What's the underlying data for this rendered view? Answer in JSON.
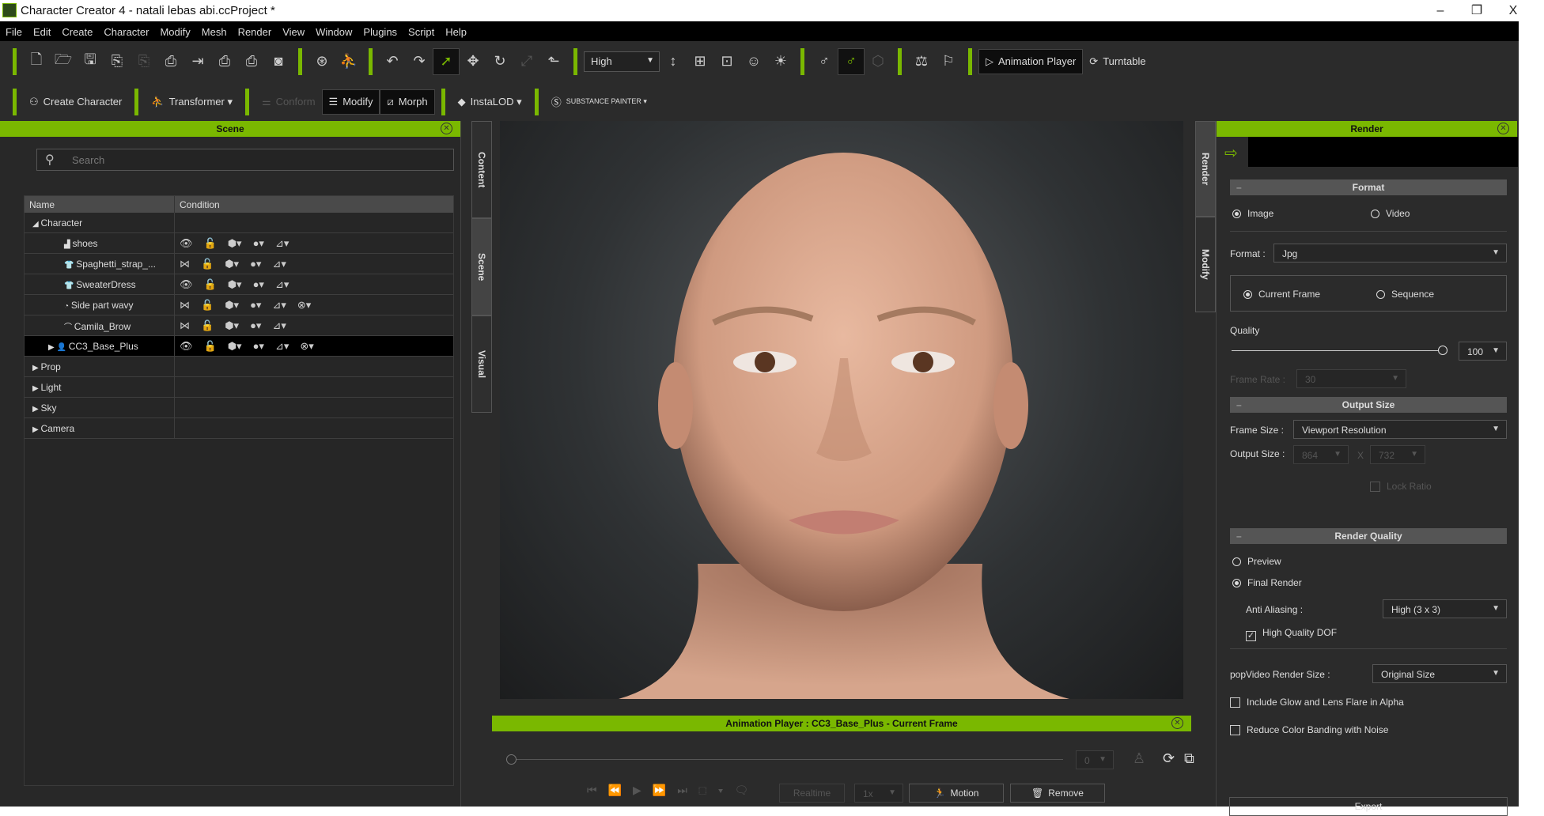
{
  "window": {
    "title": "Character Creator 4 - natali lebas abi.ccProject *",
    "minimize": "–",
    "restore": "❐",
    "close": "X"
  },
  "menu": [
    "File",
    "Edit",
    "Create",
    "Character",
    "Modify",
    "Mesh",
    "Render",
    "View",
    "Window",
    "Plugins",
    "Script",
    "Help"
  ],
  "toolbar1": [
    {
      "t": "sep"
    },
    {
      "t": "ic",
      "icon": "new-file-icon",
      "g": "🗋"
    },
    {
      "t": "ic",
      "icon": "open-folder-icon",
      "g": "🗁"
    },
    {
      "t": "ic",
      "icon": "save-icon",
      "g": "🖫"
    },
    {
      "t": "ic",
      "icon": "import-character-icon",
      "g": "⎘"
    },
    {
      "t": "ic",
      "icon": "import-ic-icon",
      "g": "⎘",
      "dim": true
    },
    {
      "t": "ic",
      "icon": "export-usd-icon",
      "g": "⎙"
    },
    {
      "t": "ic",
      "icon": "export-icon",
      "g": "⇥"
    },
    {
      "t": "ic",
      "icon": "export-obj-icon",
      "g": "⎙"
    },
    {
      "t": "ic",
      "icon": "export-fbx-icon",
      "g": "⎙"
    },
    {
      "t": "ic",
      "icon": "render-target-icon",
      "g": "◙"
    },
    {
      "t": "sep"
    },
    {
      "t": "ic",
      "icon": "headshot-icon",
      "g": "⊛"
    },
    {
      "t": "ic",
      "icon": "pose-icon",
      "g": "⛹"
    },
    {
      "t": "sep"
    },
    {
      "t": "ic",
      "icon": "undo-icon",
      "g": "↶"
    },
    {
      "t": "ic",
      "icon": "redo-icon",
      "g": "↷"
    },
    {
      "t": "ic",
      "icon": "select-arrow-icon",
      "g": "➚",
      "on": true
    },
    {
      "t": "ic",
      "icon": "move-icon",
      "g": "✥"
    },
    {
      "t": "ic",
      "icon": "rotate-icon",
      "g": "↻"
    },
    {
      "t": "ic",
      "icon": "scale-icon",
      "g": "⤢",
      "dim": true
    },
    {
      "t": "ic",
      "icon": "align-icon",
      "g": "⬑"
    },
    {
      "t": "sep"
    },
    {
      "t": "sel",
      "label": "High"
    },
    {
      "t": "ic",
      "icon": "fit-height-icon",
      "g": "↕"
    },
    {
      "t": "ic",
      "icon": "fit-view-icon",
      "g": "⊞"
    },
    {
      "t": "ic",
      "icon": "camera-view-icon",
      "g": "⊡"
    },
    {
      "t": "ic",
      "icon": "face-icon",
      "g": "☺"
    },
    {
      "t": "ic",
      "icon": "light-icon",
      "g": "☀"
    },
    {
      "t": "sep"
    },
    {
      "t": "ic",
      "icon": "bone-icon",
      "g": "♂"
    },
    {
      "t": "ic",
      "icon": "bone-active-icon",
      "g": "♂",
      "on": true
    },
    {
      "t": "ic",
      "icon": "cubes-icon",
      "g": "⬡",
      "dim": true
    },
    {
      "t": "sep"
    },
    {
      "t": "ic",
      "icon": "balance-icon",
      "g": "⚖"
    },
    {
      "t": "ic",
      "icon": "flag-icon",
      "g": "⚐"
    },
    {
      "t": "sep"
    },
    {
      "t": "btn",
      "icon": "play-circle-icon",
      "g": "▷",
      "label": "Animation Player",
      "dark": true
    },
    {
      "t": "btn",
      "icon": "turntable-icon",
      "g": "⟳",
      "label": "Turntable"
    }
  ],
  "toolbar2": [
    {
      "t": "sep"
    },
    {
      "t": "btn",
      "icon": "create-character-icon",
      "g": "⚇",
      "label": "Create Character"
    },
    {
      "t": "sep"
    },
    {
      "t": "btn",
      "icon": "transformer-icon",
      "g": "⛹",
      "label": "Transformer ▾"
    },
    {
      "t": "sep"
    },
    {
      "t": "btn",
      "icon": "conform-icon",
      "g": "⚌",
      "label": "Conform",
      "dim": true
    },
    {
      "t": "btn",
      "icon": "sliders-icon",
      "g": "☰",
      "label": "Modify",
      "dark": true
    },
    {
      "t": "btn",
      "icon": "morph-icon",
      "g": "⧄",
      "label": "Morph",
      "dark": true
    },
    {
      "t": "sep"
    },
    {
      "t": "btn",
      "icon": "instalod-icon",
      "g": "◆",
      "label": "InstaLOD ▾"
    },
    {
      "t": "sep"
    },
    {
      "t": "btn",
      "icon": "substance-painter-icon",
      "g": "Ⓢ",
      "label": "SUBSTANCE PAINTER ▾"
    }
  ],
  "scene": {
    "title": "Scene",
    "search_placeholder": "Search",
    "columns": [
      "Name",
      "Condition"
    ],
    "rows": [
      {
        "name": "Character",
        "level": 0,
        "arrow": "◢",
        "icons": []
      },
      {
        "name": "shoes",
        "level": 2,
        "icon": "▟",
        "icons": [
          "👁",
          "🔓",
          "⬢▾",
          "●▾",
          "⊿▾"
        ]
      },
      {
        "name": "Spaghetti_strap_...",
        "level": 2,
        "icon": "👕",
        "icons": [
          "⋈",
          "🔓",
          "⬢▾",
          "●▾",
          "⊿▾"
        ]
      },
      {
        "name": "SweaterDress",
        "level": 2,
        "icon": "👕",
        "icons": [
          "👁",
          "🔓",
          "⬢▾",
          "●▾",
          "⊿▾"
        ]
      },
      {
        "name": "Side part wavy",
        "level": 2,
        "icon": "◔",
        "icons": [
          "⋈",
          "🔓",
          "⬢▾",
          "●▾",
          "⊿▾",
          "⊗▾"
        ]
      },
      {
        "name": "Camila_Brow",
        "level": 2,
        "icon": "⌒",
        "icons": [
          "⋈",
          "🔓",
          "⬢▾",
          "●▾",
          "⊿▾"
        ]
      },
      {
        "name": "CC3_Base_Plus",
        "level": 1,
        "arrow": "▶",
        "icon": "👤",
        "icons": [
          "👁",
          "🔓",
          "⬢▾",
          "●▾",
          "⊿▾",
          "⊗▾"
        ],
        "selected": true
      },
      {
        "name": "Prop",
        "level": 0,
        "arrow": "▶",
        "icons": []
      },
      {
        "name": "Light",
        "level": 0,
        "arrow": "▶",
        "icons": []
      },
      {
        "name": "Sky",
        "level": 0,
        "arrow": "▶",
        "icons": []
      },
      {
        "name": "Camera",
        "level": 0,
        "arrow": "▶",
        "icons": []
      }
    ]
  },
  "left_tabs": [
    "Content",
    "Scene",
    "Visual"
  ],
  "right_tabs": [
    "Render",
    "Modify"
  ],
  "animation_player": {
    "title": "Animation Player : CC3_Base_Plus - Current Frame",
    "frame": "0",
    "realtime": "Realtime",
    "speed": "1x",
    "motion": "Motion",
    "remove": "Remove",
    "progress": 0
  },
  "render": {
    "title": "Render",
    "format_section": "Format",
    "image": "Image",
    "video": "Video",
    "output_type": "Image",
    "format_label": "Format :",
    "format_value": "Jpg",
    "current_frame": "Current Frame",
    "sequence": "Sequence",
    "quality_label": "Quality",
    "quality_value": "100",
    "frame_rate_label": "Frame Rate :",
    "frame_rate_value": "30",
    "output_section": "Output Size",
    "frame_size_label": "Frame Size :",
    "frame_size_value": "Viewport Resolution",
    "output_size_label": "Output Size :",
    "width": "864",
    "x": "X",
    "height": "732",
    "lock_ratio": "Lock Ratio",
    "quality_section": "Render Quality",
    "preview": "Preview",
    "final": "Final Render",
    "aa_label": "Anti Aliasing :",
    "aa_value": "High (3 x 3)",
    "dof": "High Quality DOF",
    "dof_checked": true,
    "popvideo_label": "popVideo Render Size :",
    "popvideo_value": "Original Size",
    "glow": "Include Glow and Lens Flare in Alpha",
    "glow_checked": false,
    "banding": "Reduce Color Banding with Noise",
    "banding_checked": false,
    "export": "Export"
  },
  "colors": {
    "accent": "#7ab800",
    "panel": "#2b2b2b",
    "menubar": "#000000"
  }
}
